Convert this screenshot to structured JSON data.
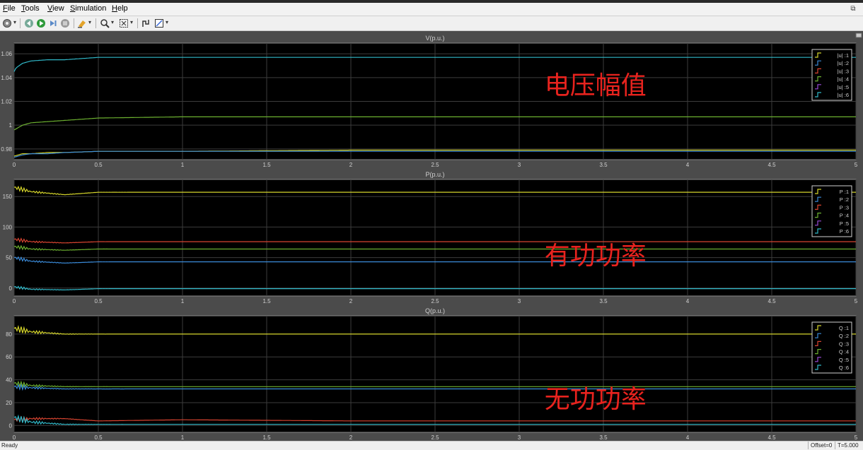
{
  "menu": {
    "items": [
      {
        "label": "File",
        "key": "F",
        "rest": "ile"
      },
      {
        "label": "Tools",
        "key": "T",
        "rest": "ools"
      },
      {
        "label": "View",
        "key": "V",
        "rest": "iew"
      },
      {
        "label": "Simulation",
        "key": "S",
        "rest": "imulation"
      },
      {
        "label": "Help",
        "key": "H",
        "rest": "elp"
      }
    ]
  },
  "toolbar": {
    "icons": [
      "settings-icon",
      "step-back-icon",
      "run-icon",
      "step-forward-icon",
      "stop-icon",
      "highlight-icon",
      "zoom-icon",
      "autoscale-icon",
      "cursor-measure-icon",
      "style-icon"
    ]
  },
  "colors": {
    "plot_bg": "#000000",
    "frame_bg": "#4b4b4b",
    "grid": "#3c3c3c",
    "text": "#d0d0d0",
    "annotation": "#e8231e",
    "series": [
      "#d4d42a",
      "#3a8ad8",
      "#d84430",
      "#6cb030",
      "#9a4ad8",
      "#30b8c8"
    ]
  },
  "chart_data": [
    {
      "type": "line",
      "title": "V(p.u.)",
      "annotation": "电压幅值",
      "xlim": [
        0,
        5
      ],
      "ylim": [
        0.971,
        1.069
      ],
      "yticks": [
        "0.98",
        "1",
        "1.02",
        "1.04",
        "1.06"
      ],
      "ytick_values": [
        0.98,
        1.0,
        1.02,
        1.04,
        1.06
      ],
      "xticks": [
        "0",
        "0.5",
        "1",
        "1.5",
        "2",
        "2.5",
        "3",
        "3.5",
        "4",
        "4.5",
        "5"
      ],
      "legend": [
        "|u| :1",
        "|u| :2",
        "|u| :3",
        "|u| :4",
        "|u| :5",
        "|u| :6"
      ],
      "series": [
        {
          "name": "|u| :1",
          "x": [
            0,
            0.05,
            0.1,
            0.2,
            0.3,
            0.5,
            1,
            2,
            3,
            4,
            5
          ],
          "y": [
            0.974,
            0.976,
            0.976,
            0.977,
            0.977,
            0.978,
            0.978,
            0.979,
            0.979,
            0.979,
            0.979
          ]
        },
        {
          "name": "|u| :2",
          "x": [
            0,
            0.05,
            0.1,
            0.2,
            0.3,
            0.5,
            1,
            2,
            3,
            4,
            5
          ],
          "y": [
            0.973,
            0.975,
            0.976,
            0.976,
            0.977,
            0.978,
            0.978,
            0.978,
            0.978,
            0.978,
            0.978
          ]
        },
        {
          "name": "|u| :4",
          "x": [
            0,
            0.05,
            0.1,
            0.2,
            0.3,
            0.5,
            1,
            2,
            3,
            4,
            5
          ],
          "y": [
            0.996,
            1.0,
            1.002,
            1.003,
            1.004,
            1.006,
            1.007,
            1.007,
            1.007,
            1.007,
            1.007
          ]
        },
        {
          "name": "|u| :6",
          "x": [
            0,
            0.01,
            0.05,
            0.1,
            0.2,
            0.3,
            0.5,
            1,
            2,
            3,
            4,
            5
          ],
          "y": [
            1.045,
            1.048,
            1.052,
            1.054,
            1.055,
            1.055,
            1.057,
            1.057,
            1.057,
            1.057,
            1.057,
            1.057
          ]
        }
      ]
    },
    {
      "type": "line",
      "title": "P(p.u.)",
      "annotation": "有功功率",
      "xlim": [
        0,
        5
      ],
      "ylim": [
        -13,
        178
      ],
      "yticks": [
        "0",
        "50",
        "100",
        "150"
      ],
      "ytick_values": [
        0,
        50,
        100,
        150
      ],
      "xticks": [
        "0",
        "0.5",
        "1",
        "1.5",
        "2",
        "2.5",
        "3",
        "3.5",
        "4",
        "4.5",
        "5"
      ],
      "legend": [
        "P :1",
        "P :2",
        "P :3",
        "P :4",
        "P :5",
        "P :6"
      ],
      "series": [
        {
          "name": "P :1",
          "x": [
            0,
            0.1,
            0.3,
            0.5,
            1,
            2,
            3,
            5
          ],
          "y": [
            165,
            158,
            153,
            157,
            157,
            157,
            157,
            157
          ],
          "osc": 5
        },
        {
          "name": "P :2",
          "x": [
            0,
            0.1,
            0.3,
            0.5,
            1,
            2,
            3,
            5
          ],
          "y": [
            50,
            44,
            41,
            43,
            43,
            43,
            43,
            43
          ],
          "osc": 4
        },
        {
          "name": "P :3",
          "x": [
            0,
            0.1,
            0.3,
            0.5,
            1,
            2,
            3,
            5
          ],
          "y": [
            80,
            76,
            74,
            76,
            76,
            76,
            76,
            76
          ],
          "osc": 4
        },
        {
          "name": "P :4",
          "x": [
            0,
            0.1,
            0.3,
            0.5,
            1,
            2,
            3,
            5
          ],
          "y": [
            68,
            64,
            62,
            64,
            64,
            64,
            64,
            64
          ],
          "osc": 4
        },
        {
          "name": "P :6",
          "x": [
            0,
            0.1,
            0.3,
            0.5,
            1,
            2,
            3,
            5
          ],
          "y": [
            2,
            -2,
            -3,
            -1,
            -1,
            -1,
            -1,
            -1
          ],
          "osc": 3
        }
      ]
    },
    {
      "type": "line",
      "title": "Q(p.u.)",
      "annotation": "无功功率",
      "xlim": [
        0,
        5
      ],
      "ylim": [
        -6,
        96
      ],
      "yticks": [
        "0",
        "20",
        "40",
        "60",
        "80"
      ],
      "ytick_values": [
        0,
        20,
        40,
        60,
        80
      ],
      "xticks": [
        "0",
        "0.5",
        "1",
        "1.5",
        "2",
        "2.5",
        "3",
        "3.5",
        "4",
        "4.5",
        "5"
      ],
      "legend": [
        "Q :1",
        "Q :2",
        "Q :3",
        "Q :4",
        "Q :5",
        "Q :6"
      ],
      "series": [
        {
          "name": "Q :1",
          "x": [
            0,
            0.1,
            0.3,
            0.5,
            1,
            2,
            3,
            5
          ],
          "y": [
            85,
            82,
            80,
            80,
            80,
            80,
            80,
            80
          ],
          "osc": 4
        },
        {
          "name": "Q :2",
          "x": [
            0,
            0.1,
            0.3,
            0.5,
            1,
            2,
            3,
            5
          ],
          "y": [
            34,
            33,
            32,
            32,
            32,
            32,
            32,
            32
          ],
          "osc": 3
        },
        {
          "name": "Q :3",
          "x": [
            0,
            0.1,
            0.3,
            0.5,
            1,
            2,
            3,
            5
          ],
          "y": [
            5,
            6,
            6,
            4,
            5,
            4,
            4,
            4
          ],
          "osc": 3
        },
        {
          "name": "Q :4",
          "x": [
            0,
            0.1,
            0.3,
            0.5,
            1,
            2,
            3,
            5
          ],
          "y": [
            37,
            35,
            34,
            34,
            34,
            34,
            34,
            34
          ],
          "osc": 3
        },
        {
          "name": "Q :6",
          "x": [
            0,
            0.1,
            0.3,
            0.5,
            1,
            2,
            3,
            5
          ],
          "y": [
            7,
            3,
            1,
            1,
            1,
            1,
            1,
            1
          ],
          "osc": 4
        }
      ]
    }
  ],
  "status": {
    "left": "Ready",
    "offset": "Offset=0",
    "time": "T=5.000"
  }
}
